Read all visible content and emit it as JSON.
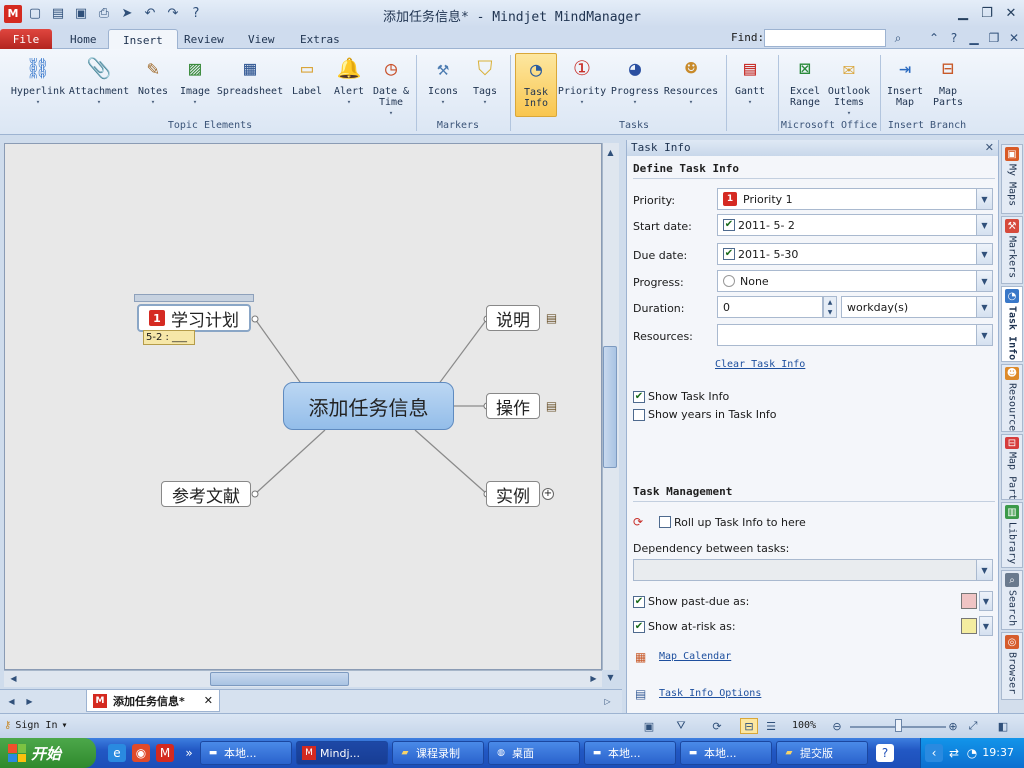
{
  "window": {
    "logo": "M",
    "title": "添加任务信息* - Mindjet MindManager",
    "quick_access_icons": [
      "new-doc-icon",
      "open-folder-icon",
      "save-icon",
      "print-icon",
      "send-icon",
      "undo-icon",
      "redo-icon",
      "help-icon"
    ]
  },
  "ribbon_tabs": [
    "File",
    "Home",
    "Insert",
    "Review",
    "View",
    "Extras"
  ],
  "active_tab": "Insert",
  "find": {
    "label": "Find:",
    "value": ""
  },
  "ribbon": {
    "buttons": [
      {
        "label": "Hyperlink",
        "icon": "link-icon"
      },
      {
        "label": "Attachment",
        "icon": "paperclip-icon"
      },
      {
        "label": "Notes",
        "icon": "notes-icon"
      },
      {
        "label": "Image",
        "icon": "image-icon"
      },
      {
        "label": "Spreadsheet",
        "icon": "spreadsheet-icon"
      },
      {
        "label": "Label",
        "icon": "label-icon"
      },
      {
        "label": "Alert",
        "icon": "bell-icon"
      },
      {
        "label": "Date &",
        "label2": "Time",
        "icon": "calendar-clock-icon"
      },
      {
        "label": "Icons",
        "icon": "hammer-icon"
      },
      {
        "label": "Tags",
        "icon": "tags-icon"
      },
      {
        "label": "Task",
        "label2": "Info",
        "icon": "task-info-icon"
      },
      {
        "label": "Priority",
        "icon": "priority-icon"
      },
      {
        "label": "Progress",
        "icon": "progress-icon"
      },
      {
        "label": "Resources",
        "icon": "person-icon"
      },
      {
        "label": "Gantt",
        "icon": "gantt-icon"
      },
      {
        "label": "Excel",
        "label2": "Range",
        "icon": "excel-icon"
      },
      {
        "label": "Outlook",
        "label2": "Items",
        "icon": "outlook-icon"
      },
      {
        "label": "Insert",
        "label2": "Map",
        "icon": "insert-map-icon"
      },
      {
        "label": "Map",
        "label2": "Parts",
        "icon": "map-parts-icon"
      }
    ],
    "groups": [
      "Topic Elements",
      "Markers",
      "Tasks",
      "Microsoft Office",
      "Insert Branch"
    ]
  },
  "map": {
    "central": "添加任务信息",
    "topics": [
      {
        "text": "学习计划",
        "priority": "1",
        "date_tag": "5-2 : ___"
      },
      {
        "text": "说明"
      },
      {
        "text": "操作"
      },
      {
        "text": "参考文献"
      },
      {
        "text": "实例"
      }
    ]
  },
  "doc_tab": {
    "title": "添加任务信息*"
  },
  "task_panel": {
    "title": "Task Info",
    "define_section": "Define Task Info",
    "priority_label": "Priority:",
    "priority_value": "Priority 1",
    "priority_badge": "1",
    "start_label": "Start date:",
    "start_value": "2011- 5- 2",
    "due_label": "Due date:",
    "due_value": "2011- 5-30",
    "progress_label": "Progress:",
    "progress_value": "None",
    "duration_label": "Duration:",
    "duration_value": "0",
    "duration_unit": "workday(s)",
    "resources_label": "Resources:",
    "resources_value": "",
    "clear_link": "Clear Task Info",
    "show_task_info": "Show Task Info",
    "show_years": "Show years in Task Info",
    "management_section": "Task Management",
    "rollup": "Roll up Task Info to here",
    "dependency_label": "Dependency between tasks:",
    "past_due": "Show past-due as:",
    "at_risk": "Show at-risk as:",
    "past_due_color": "#f0c4c4",
    "at_risk_color": "#f4eda0",
    "map_calendar": "Map Calendar",
    "options_link": "Task Info Options"
  },
  "side_tabs": [
    {
      "label": "My Maps",
      "color": "#d95a26"
    },
    {
      "label": "Markers",
      "color": "#d64a3c"
    },
    {
      "label": "Task Info",
      "color": "#3a78c8"
    },
    {
      "label": "Resources",
      "color": "#dd8a2a"
    },
    {
      "label": "Map Parts",
      "color": "#d63c3c"
    },
    {
      "label": "Library",
      "color": "#3c9a4a"
    },
    {
      "label": "Search",
      "color": "#6a7a8e"
    },
    {
      "label": "Browser",
      "color": "#d65c2c"
    }
  ],
  "status": {
    "signin": "Sign In",
    "zoom": "100%",
    "zoom_fraction": 0.5
  },
  "taskbar": {
    "start": "开始",
    "buttons": [
      "本地...",
      "Mindj...",
      "课程录制",
      "桌面",
      "本地...",
      "本地...",
      "提交版"
    ],
    "clock": "19:37"
  }
}
